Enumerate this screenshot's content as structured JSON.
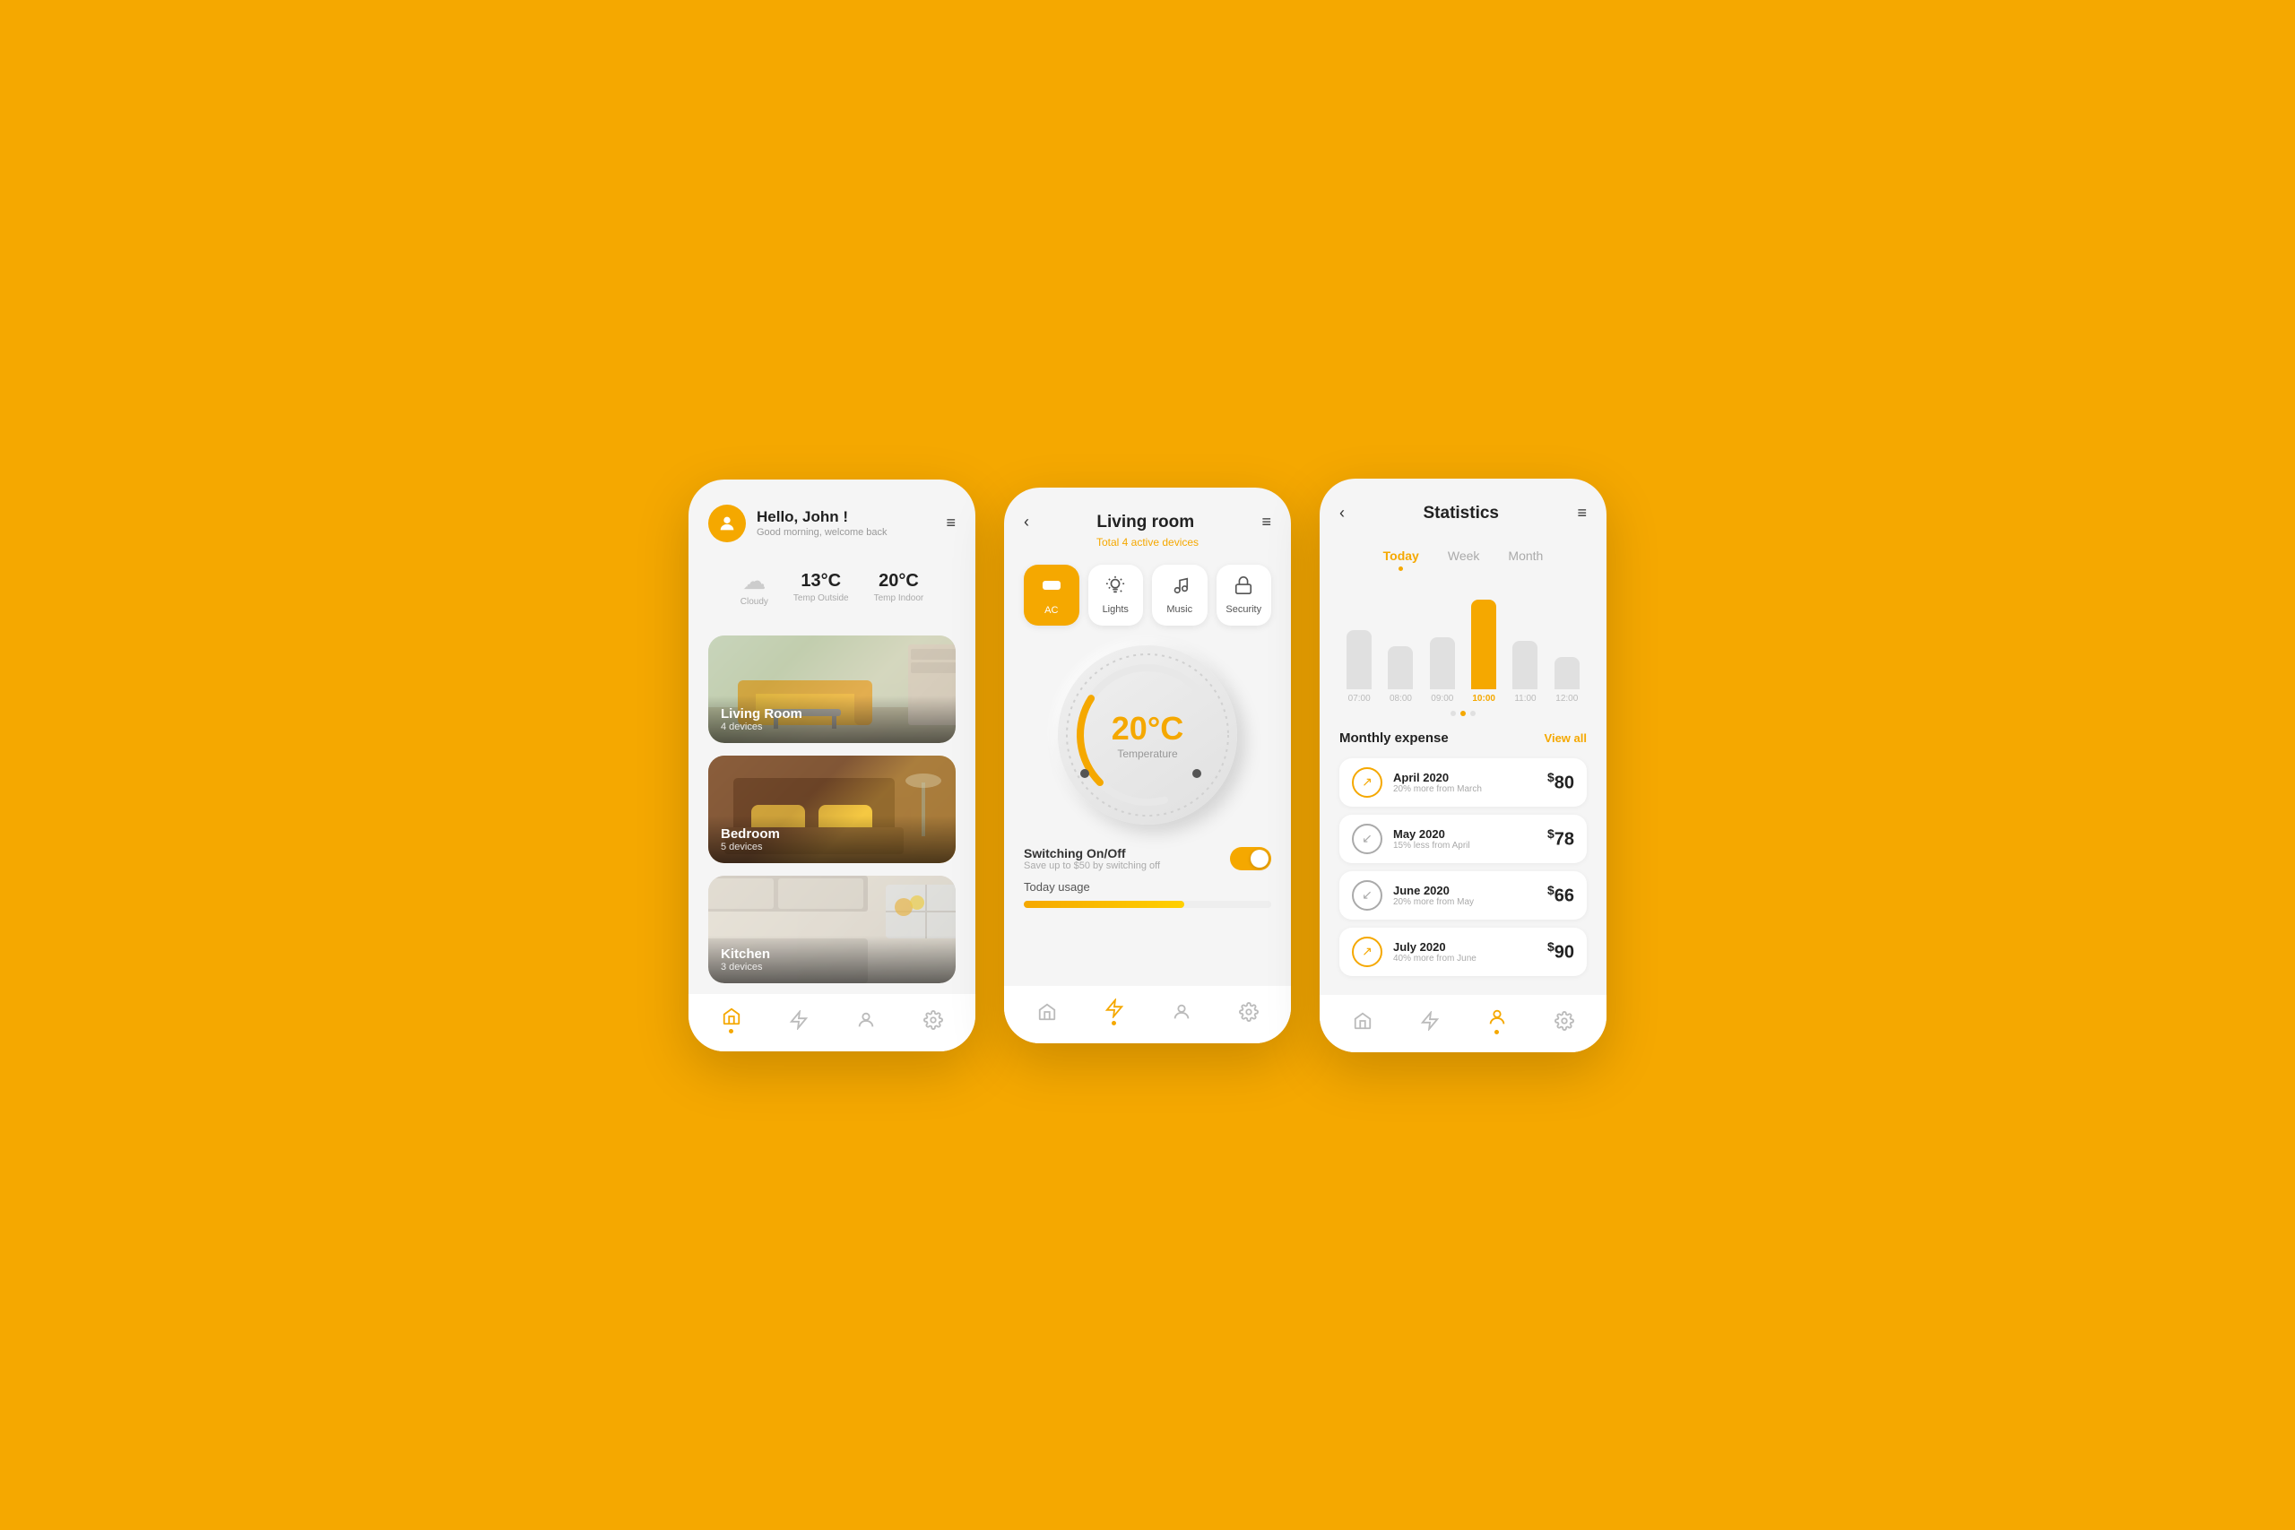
{
  "background_color": "#F5A800",
  "screen1": {
    "greeting": "Hello, ",
    "name": "John !",
    "subtitle": "Good morning, welcome back",
    "menu_icon": "≡",
    "weather": {
      "icon": "☁",
      "condition": "Cloudy",
      "temp_outside": "13°C",
      "temp_outside_label": "Temp Outside",
      "temp_inside": "20°C",
      "temp_inside_label": "Temp Indoor"
    },
    "rooms": [
      {
        "name": "Living Room",
        "devices": "4 devices",
        "type": "living"
      },
      {
        "name": "Bedroom",
        "devices": "5 devices",
        "type": "bedroom"
      },
      {
        "name": "Kitchen",
        "devices": "3 devices",
        "type": "kitchen"
      }
    ],
    "nav": [
      {
        "icon": "⌂",
        "active": true,
        "label": "home"
      },
      {
        "icon": "⚡",
        "active": false,
        "label": "power"
      },
      {
        "icon": "👤",
        "active": false,
        "label": "profile"
      },
      {
        "icon": "⚙",
        "active": false,
        "label": "settings"
      }
    ]
  },
  "screen2": {
    "back_icon": "‹",
    "title": "Living room",
    "subtitle": "Total 4 active devices",
    "menu_icon": "≡",
    "tabs": [
      {
        "label": "AC",
        "icon": "❄",
        "active": true
      },
      {
        "label": "Lights",
        "icon": "💡",
        "active": false
      },
      {
        "label": "Music",
        "icon": "♪",
        "active": false
      },
      {
        "label": "Security",
        "icon": "🔒",
        "active": false
      }
    ],
    "thermostat": {
      "temperature": "20°C",
      "label": "Temperature"
    },
    "switching": {
      "title": "Switching On/Off",
      "subtitle": "Save up to $50 by switching off",
      "enabled": true
    },
    "usage": {
      "title": "Today usage",
      "percent": 65
    },
    "nav": [
      {
        "icon": "⌂",
        "active": false,
        "label": "home"
      },
      {
        "icon": "⚡",
        "active": true,
        "label": "power"
      },
      {
        "icon": "👤",
        "active": false,
        "label": "profile"
      },
      {
        "icon": "⚙",
        "active": false,
        "label": "settings"
      }
    ]
  },
  "screen3": {
    "back_icon": "‹",
    "title": "Statistics",
    "menu_icon": "≡",
    "time_tabs": [
      {
        "label": "Today",
        "active": true
      },
      {
        "label": "Week",
        "active": false
      },
      {
        "label": "Month",
        "active": false
      }
    ],
    "chart": {
      "bars": [
        {
          "label": "07:00",
          "height": 55,
          "type": "gray",
          "active": false
        },
        {
          "label": "08:00",
          "height": 40,
          "type": "gray",
          "active": false
        },
        {
          "label": "09:00",
          "height": 48,
          "type": "gray",
          "active": false
        },
        {
          "label": "10:00",
          "height": 100,
          "type": "yellow",
          "active": true
        },
        {
          "label": "11:00",
          "height": 45,
          "type": "gray",
          "active": false
        },
        {
          "label": "12:00",
          "height": 30,
          "type": "gray",
          "active": false
        }
      ],
      "dots": [
        false,
        true,
        false
      ]
    },
    "monthly": {
      "title": "Monthly expense",
      "view_all": "View all",
      "items": [
        {
          "month": "April 2020",
          "sub": "20% more from March",
          "amount": "80",
          "arrow": "↗"
        },
        {
          "month": "May 2020",
          "sub": "15% less from April",
          "amount": "78",
          "arrow": "↙"
        },
        {
          "month": "June 2020",
          "sub": "20% more from May",
          "amount": "66",
          "arrow": "↙"
        },
        {
          "month": "July 2020",
          "sub": "40% more from June",
          "amount": "90",
          "arrow": "↗"
        }
      ]
    },
    "nav": [
      {
        "icon": "⌂",
        "active": false,
        "label": "home"
      },
      {
        "icon": "⚡",
        "active": false,
        "label": "power"
      },
      {
        "icon": "👤",
        "active": true,
        "label": "profile"
      },
      {
        "icon": "⚙",
        "active": false,
        "label": "settings"
      }
    ]
  }
}
